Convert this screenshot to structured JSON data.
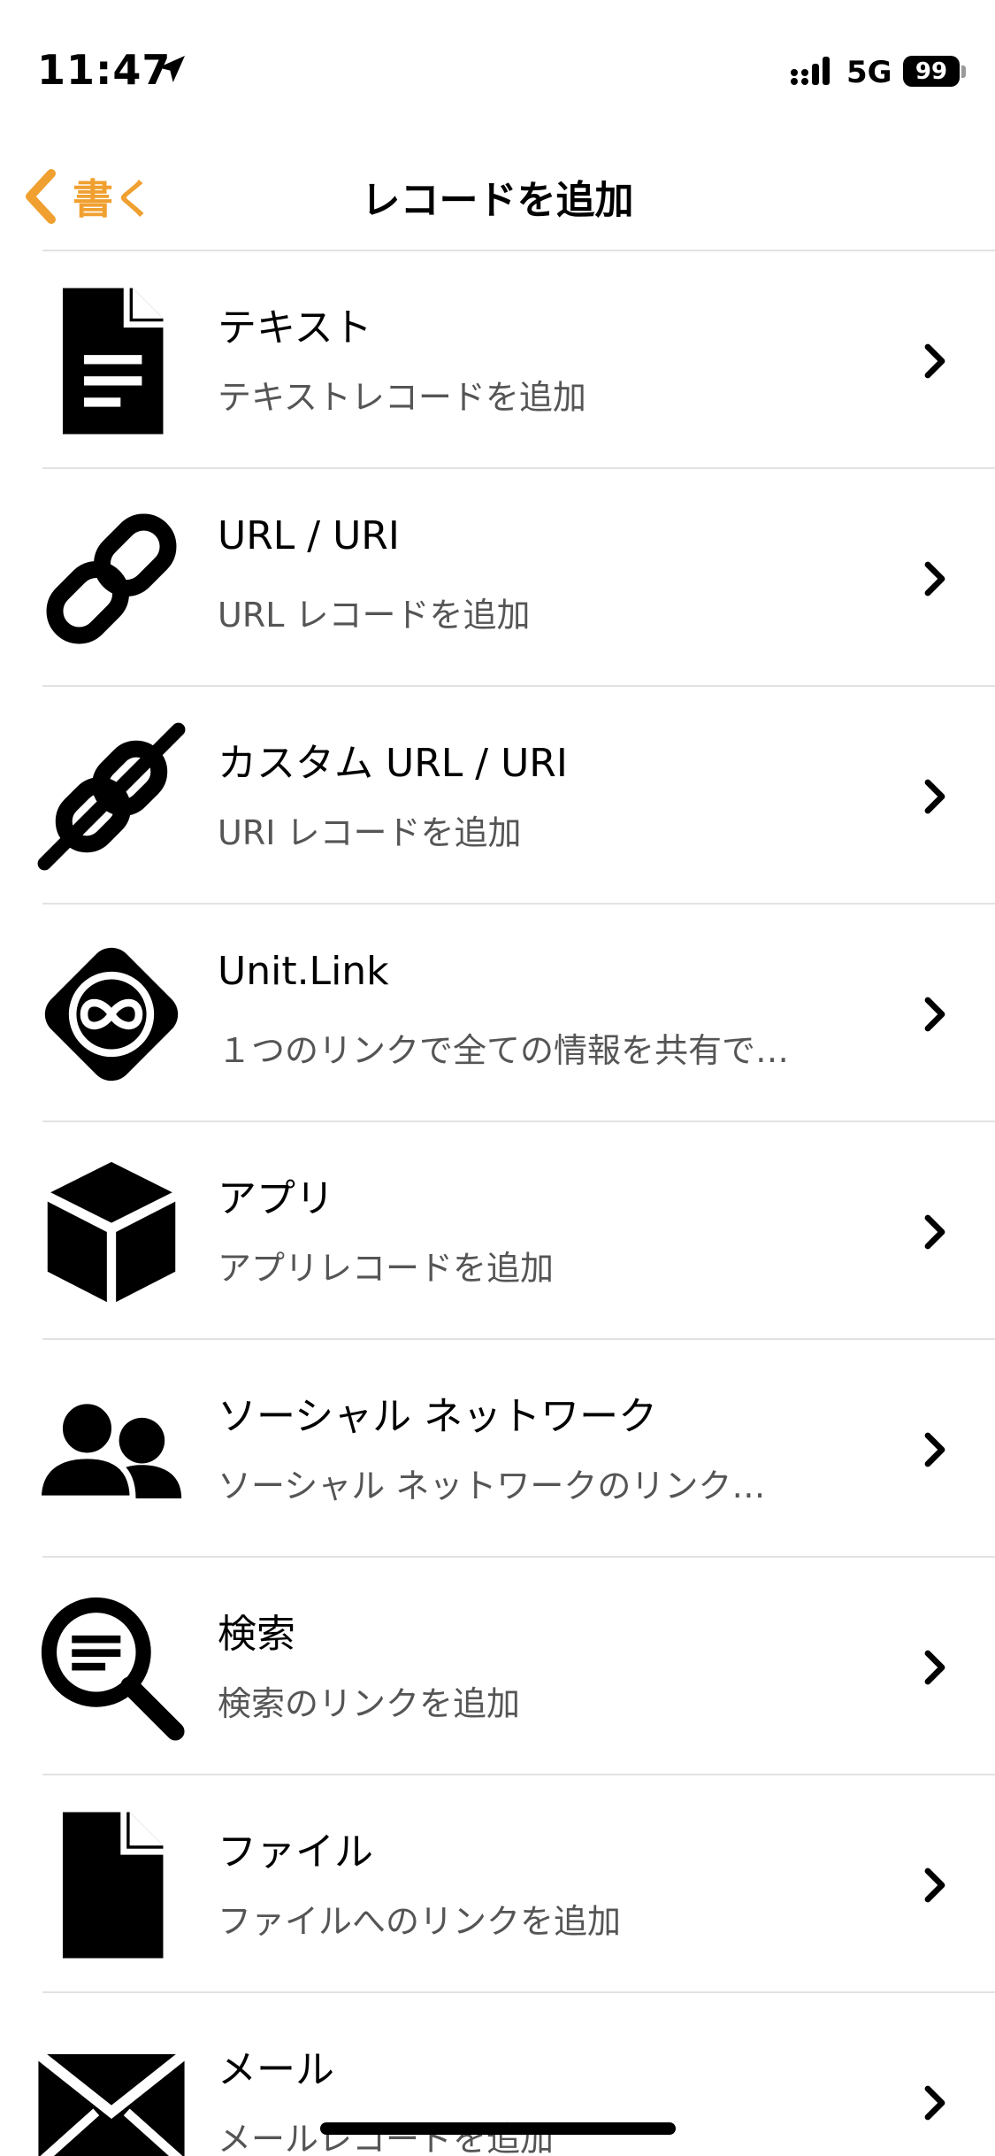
{
  "status_bar": {
    "time": "11:47",
    "network": "5G",
    "battery": "99",
    "icons": [
      "location-arrow-icon",
      "signal-icon"
    ]
  },
  "nav": {
    "back_label": "書く",
    "title": "レコードを追加",
    "accent_color": "#f0a030"
  },
  "records": [
    {
      "icon": "document-text-icon",
      "title": "テキスト",
      "subtitle": "テキストレコードを追加"
    },
    {
      "icon": "link-icon",
      "title": "URL / URI",
      "subtitle": "URL レコードを追加"
    },
    {
      "icon": "custom-link-icon",
      "title": "カスタム URL / URI",
      "subtitle": "URI レコードを追加"
    },
    {
      "icon": "unit-link-icon",
      "title": "Unit.Link",
      "subtitle": "１つのリンクで全ての情報を共有で…"
    },
    {
      "icon": "app-box-icon",
      "title": "アプリ",
      "subtitle": "アプリレコードを追加"
    },
    {
      "icon": "social-people-icon",
      "title": "ソーシャル ネットワーク",
      "subtitle": "ソーシャル ネットワークのリンク…"
    },
    {
      "icon": "search-icon",
      "title": "検索",
      "subtitle": "検索のリンクを追加"
    },
    {
      "icon": "file-icon",
      "title": "ファイル",
      "subtitle": "ファイルへのリンクを追加"
    },
    {
      "icon": "mail-icon",
      "title": "メール",
      "subtitle": "メールレコードを追加"
    }
  ]
}
